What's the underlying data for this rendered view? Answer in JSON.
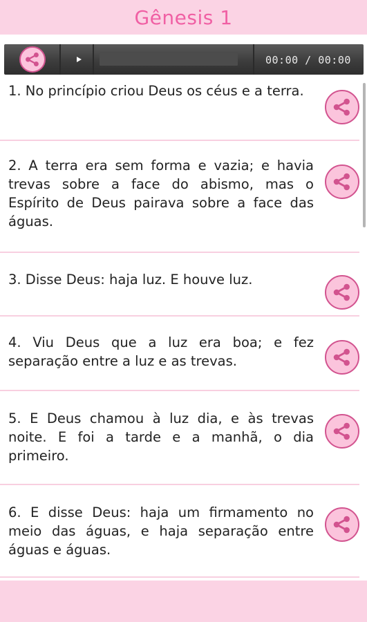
{
  "header": {
    "title": "Gênesis 1"
  },
  "player": {
    "time": "00:00 / 00:00"
  },
  "icons": {
    "share": "share-icon",
    "play": "play-icon"
  },
  "colors": {
    "accent": "#f060a4",
    "header_bg": "#fbd3e4",
    "divider": "#f8cfe0",
    "share_fill": "#fbc4dc",
    "share_stroke": "#d2538f"
  },
  "verses": [
    {
      "text": "1. No princípio criou Deus os céus e a terra."
    },
    {
      "text": "2. A terra era sem forma e vazia; e havia trevas sobre a face do abismo, mas o Espírito de Deus pairava sobre a face das águas."
    },
    {
      "text": "3. Disse Deus: haja luz. E houve luz."
    },
    {
      "text": "4. Viu Deus que a luz era boa; e fez separação entre a luz e as trevas."
    },
    {
      "text": "5. E Deus chamou à luz dia, e às trevas noite. E foi a tarde e a manhã, o dia primeiro."
    },
    {
      "text": "6. E disse Deus: haja um firmamento no meio das águas, e haja separação entre águas e águas."
    }
  ]
}
